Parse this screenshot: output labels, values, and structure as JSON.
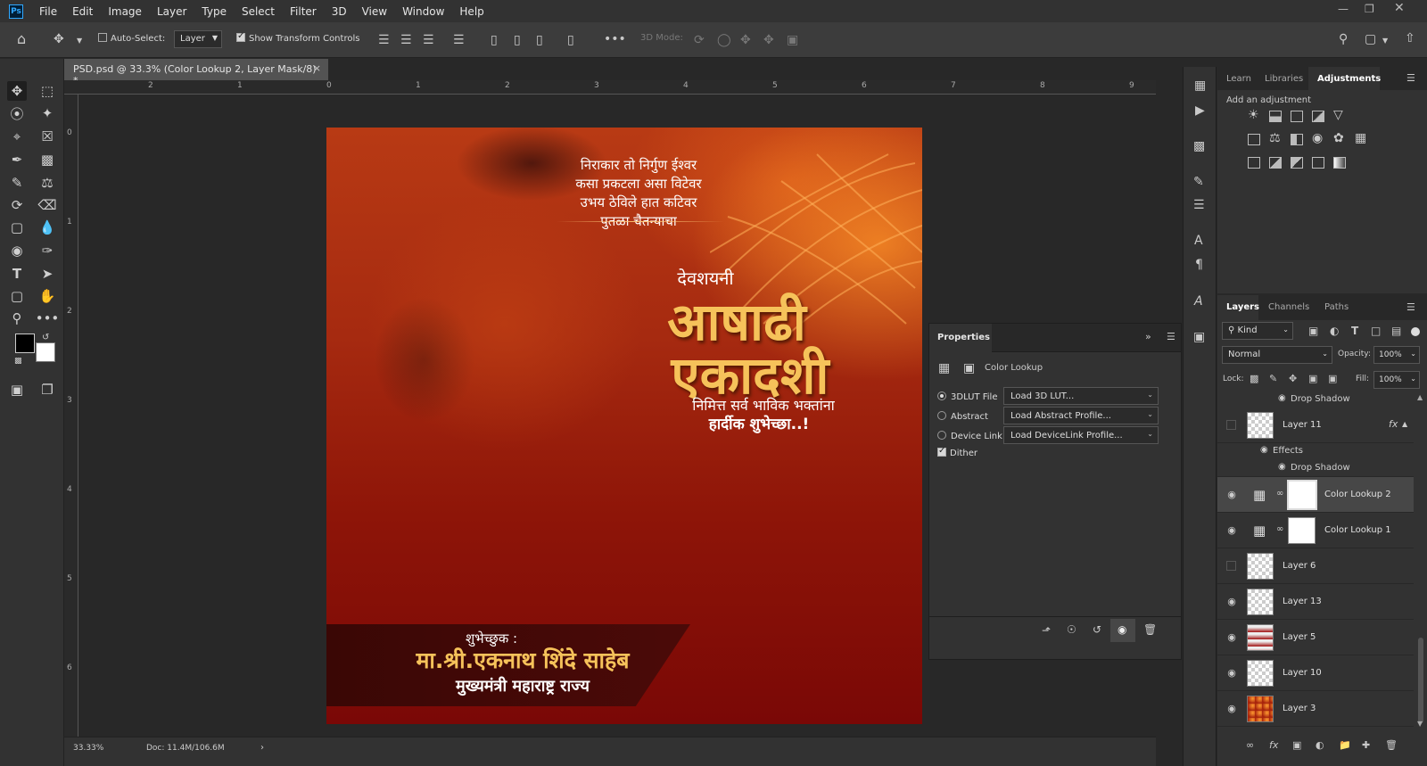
{
  "app": {
    "logo": "Ps"
  },
  "menu": [
    "File",
    "Edit",
    "Image",
    "Layer",
    "Type",
    "Select",
    "Filter",
    "3D",
    "View",
    "Window",
    "Help"
  ],
  "options_bar": {
    "auto_select_label": "Auto-Select:",
    "auto_select_checked": false,
    "auto_select_target": "Layer",
    "show_transform_label": "Show Transform Controls",
    "show_transform_checked": true,
    "mode_3d_label": "3D Mode:"
  },
  "document": {
    "tab_title": "PSD.psd @ 33.3% (Color Lookup 2, Layer Mask/8) *",
    "close_glyph": "×",
    "ruler_top": [
      "2",
      "1",
      "0",
      "1",
      "2",
      "3",
      "4",
      "5",
      "6",
      "7",
      "8",
      "9"
    ],
    "ruler_left": [
      "0",
      "1",
      "2",
      "3",
      "4",
      "5",
      "6"
    ],
    "zoom": "33.33%",
    "doc_size": "Doc: 11.4M/106.6M"
  },
  "artwork": {
    "poem_line1": "निराकार तो निर्गुण ईश्वर",
    "poem_line2": "कसा प्रकटला असा विटेवर",
    "poem_line3": "उभय ठेविले हात कटिवर",
    "poem_line4": "पुतळा चैतन्याचा",
    "prefix": "देवशयनी",
    "title_line1": "आषाढी",
    "title_line2": "एकादशी",
    "wish_line1": "निमित्त सर्व भाविक भक्तांना",
    "wish_line2": "हार्दीक शुभेच्छा..!",
    "greeter_label": "शुभेच्छुक :",
    "greeter_name": "मा.श्री.एकनाथ शिंदे साहेब",
    "greeter_title": "मुख्यमंत्री महाराष्ट्र राज्य"
  },
  "properties": {
    "tab": "Properties",
    "adjustment_name": "Color Lookup",
    "options": [
      {
        "label": "3DLUT File",
        "selected": true,
        "dropdown": "Load 3D LUT..."
      },
      {
        "label": "Abstract",
        "selected": false,
        "dropdown": "Load Abstract Profile..."
      },
      {
        "label": "Device Link",
        "selected": false,
        "dropdown": "Load DeviceLink Profile..."
      }
    ],
    "dither_label": "Dither",
    "dither_checked": true
  },
  "adjustments_panel": {
    "tabs": [
      "Learn",
      "Libraries",
      "Adjustments"
    ],
    "active_tab": "Adjustments",
    "subtitle": "Add an adjustment"
  },
  "layers_panel": {
    "tabs": [
      "Layers",
      "Channels",
      "Paths"
    ],
    "active_tab": "Layers",
    "filter": "Kind",
    "blend_mode": "Normal",
    "opacity_label": "Opacity:",
    "opacity": "100%",
    "lock_label": "Lock:",
    "fill_label": "Fill:",
    "fill": "100%",
    "top_effect": "Drop Shadow",
    "layers": [
      {
        "name": "Layer 11",
        "visible": false,
        "fx": "fx",
        "effects_label": "Effects",
        "effect": "Drop Shadow"
      },
      {
        "name": "Color Lookup 2",
        "visible": true,
        "selected": true,
        "type": "adjustment"
      },
      {
        "name": "Color Lookup 1",
        "visible": true,
        "type": "adjustment"
      },
      {
        "name": "Layer 6",
        "visible": false
      },
      {
        "name": "Layer 13",
        "visible": true
      },
      {
        "name": "Layer 5",
        "visible": true,
        "thumb": "gradient"
      },
      {
        "name": "Layer 10",
        "visible": true
      },
      {
        "name": "Layer 3",
        "visible": true,
        "thumb": "photo"
      }
    ]
  },
  "colors": {
    "accent": "#31a8ff",
    "gold": "#f6c25a",
    "foreground": "#000000",
    "background": "#ffffff"
  }
}
